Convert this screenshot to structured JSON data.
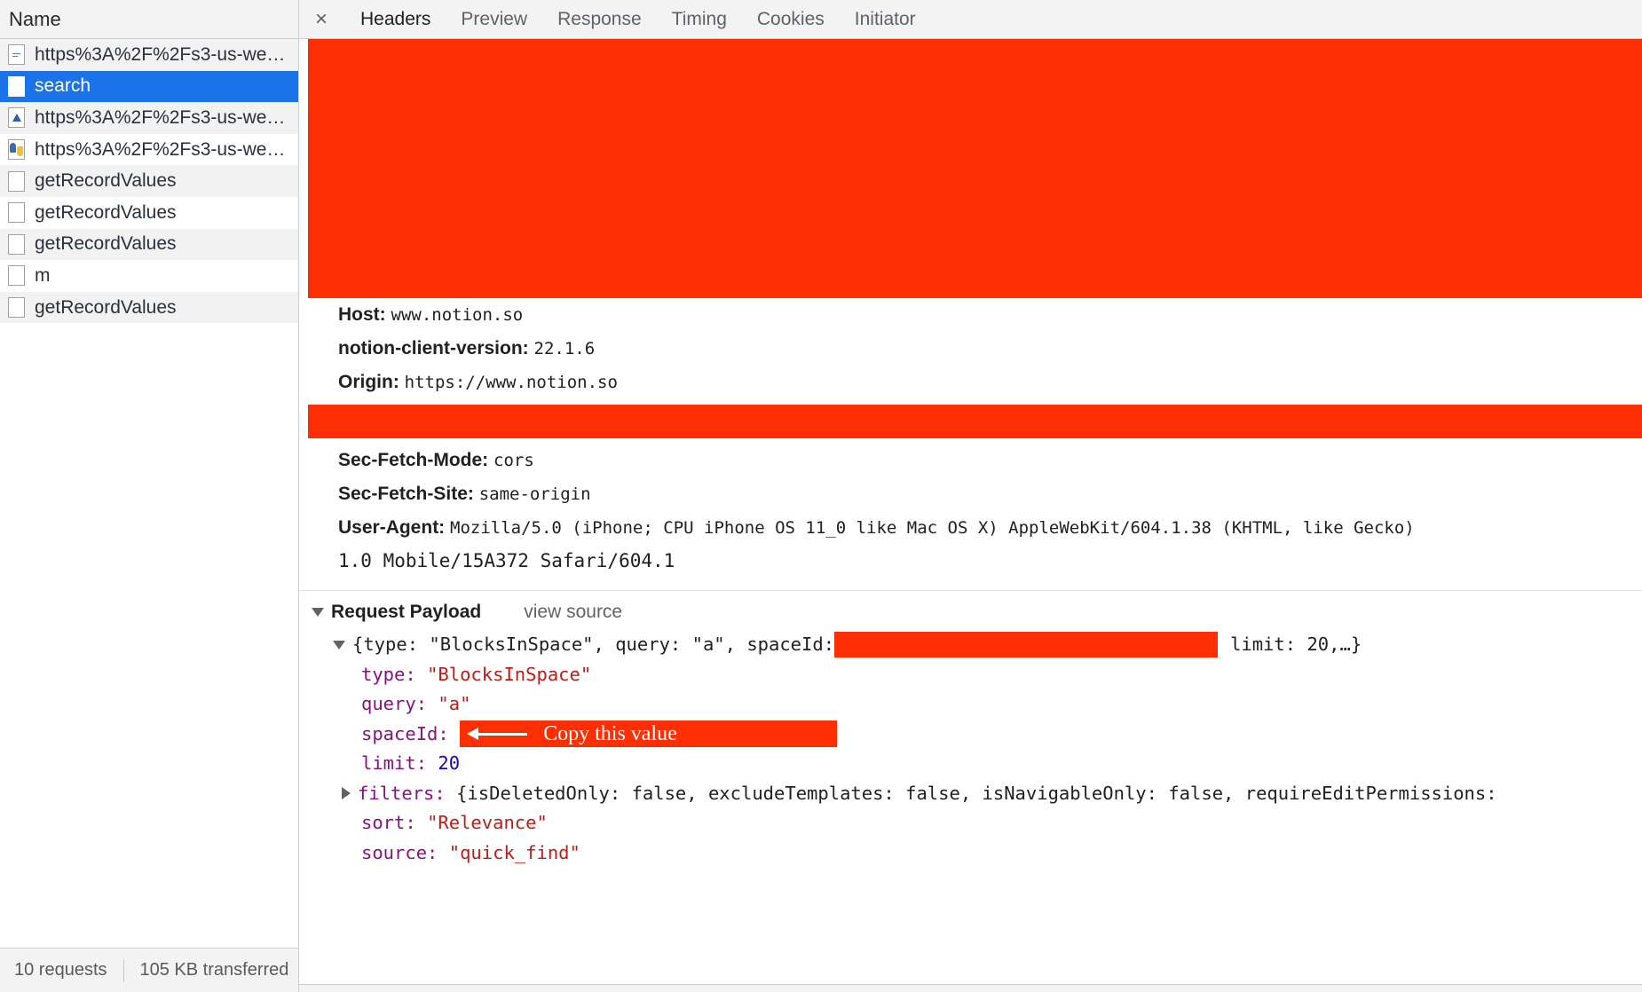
{
  "left_panel": {
    "column_header": "Name",
    "rows": [
      {
        "name": "https%3A%2F%2Fs3-us-we…",
        "icon": "document-lines-icon",
        "selected": false
      },
      {
        "name": "search",
        "icon": "document-blank-icon",
        "selected": true
      },
      {
        "name": "https%3A%2F%2Fs3-us-we…",
        "icon": "document-triangle-icon",
        "selected": false
      },
      {
        "name": "https%3A%2F%2Fs3-us-we…",
        "icon": "document-python-icon",
        "selected": false
      },
      {
        "name": "getRecordValues",
        "icon": "document-blank-icon",
        "selected": false
      },
      {
        "name": "getRecordValues",
        "icon": "document-blank-icon",
        "selected": false
      },
      {
        "name": "getRecordValues",
        "icon": "document-blank-icon",
        "selected": false
      },
      {
        "name": "m",
        "icon": "document-blank-icon",
        "selected": false
      },
      {
        "name": "getRecordValues",
        "icon": "document-blank-icon",
        "selected": false
      }
    ],
    "status": {
      "requests": "10 requests",
      "transferred": "105 KB transferred"
    }
  },
  "tabbar": {
    "close_label": "×",
    "tabs": [
      {
        "label": "Headers",
        "active": true
      },
      {
        "label": "Preview",
        "active": false
      },
      {
        "label": "Response",
        "active": false
      },
      {
        "label": "Timing",
        "active": false
      },
      {
        "label": "Cookies",
        "active": false
      },
      {
        "label": "Initiator",
        "active": false
      }
    ]
  },
  "headers": {
    "rows": [
      {
        "name": "Host:",
        "value": "www.notion.so"
      },
      {
        "name": "notion-client-version:",
        "value": "22.1.6"
      },
      {
        "name": "Origin:",
        "value": "https://www.notion.so"
      }
    ],
    "rows2": [
      {
        "name": "Sec-Fetch-Mode:",
        "value": "cors"
      },
      {
        "name": "Sec-Fetch-Site:",
        "value": "same-origin"
      }
    ],
    "user_agent": {
      "name": "User-Agent:",
      "value_line1": "Mozilla/5.0 (iPhone; CPU iPhone OS 11_0 like Mac OS X) AppleWebKit/604.1.38 (KHTML, like Gecko)",
      "value_line2": "1.0 Mobile/15A372 Safari/604.1"
    }
  },
  "payload": {
    "title": "Request Payload",
    "view_source": "view source",
    "summary": {
      "prefix": "{type: \"BlocksInSpace\", query: \"a\", spaceId: ",
      "suffix": "limit: 20,…}"
    },
    "entries": [
      {
        "key": "type:",
        "value": "\"BlocksInSpace\"",
        "value_type": "string"
      },
      {
        "key": "query:",
        "value": "\"a\"",
        "value_type": "string"
      },
      {
        "key": "spaceId:",
        "value": "",
        "value_type": "redacted"
      },
      {
        "key": "limit:",
        "value": "20",
        "value_type": "number"
      },
      {
        "key": "filters:",
        "value": "{isDeletedOnly: false, excludeTemplates: false, isNavigableOnly: false, requireEditPermissions:",
        "value_type": "object"
      },
      {
        "key": "sort:",
        "value": "\"Relevance\"",
        "value_type": "string"
      },
      {
        "key": "source:",
        "value": "\"quick_find\"",
        "value_type": "string"
      }
    ]
  },
  "annotation": {
    "text": "Copy this value",
    "arrow": "left-arrow-icon"
  },
  "colors": {
    "redaction": "#fc2f04",
    "selection": "#1a73e8",
    "json_key": "#881280",
    "json_string": "#c41a16",
    "json_number": "#1c00cf"
  }
}
